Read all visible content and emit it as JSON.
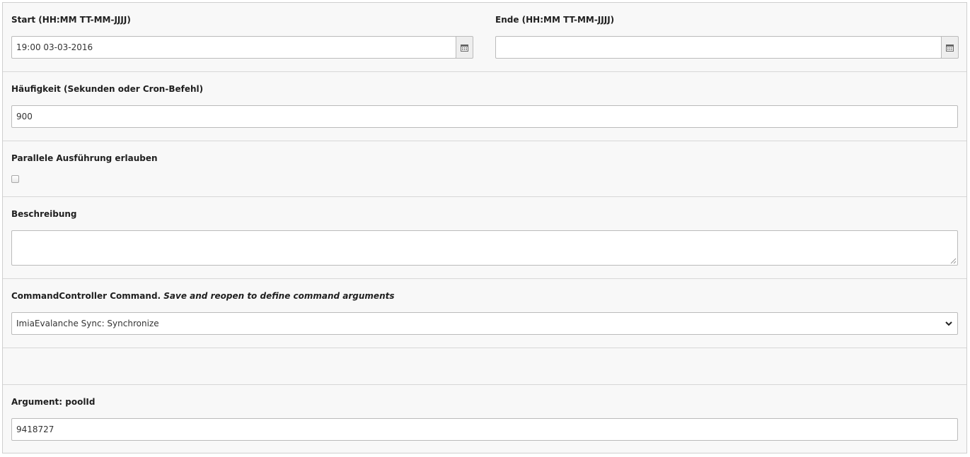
{
  "start": {
    "label": "Start (HH:MM TT-MM-JJJJ)",
    "value": "19:00 03-03-2016",
    "calendar_icon": "calendar-icon"
  },
  "end": {
    "label": "Ende (HH:MM TT-MM-JJJJ)",
    "value": "",
    "calendar_icon": "calendar-icon"
  },
  "frequency": {
    "label": "Häufigkeit (Sekunden oder Cron-Befehl)",
    "value": "900"
  },
  "parallel": {
    "label": "Parallele Ausführung erlauben",
    "checked": false
  },
  "description": {
    "label": "Beschreibung",
    "value": ""
  },
  "command": {
    "label": "CommandController Command.",
    "label_hint": "Save and reopen to define command arguments",
    "selected": "ImiaEvalanche Sync: Synchronize",
    "dropdown_icon": "chevron-down-icon"
  },
  "argument": {
    "label": "Argument: poolId",
    "value": "9418727"
  },
  "colors": {
    "panel_background": "#f8f8f8",
    "border": "#bbbbbb",
    "divider": "#d7d7d7"
  }
}
